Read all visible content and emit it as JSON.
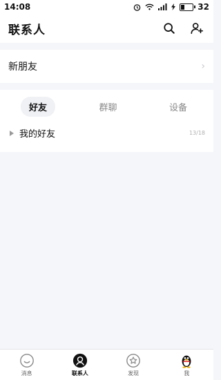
{
  "status_bar": {
    "time": "14:08",
    "battery": "32"
  },
  "header": {
    "title": "联系人"
  },
  "new_friends": {
    "label": "新朋友"
  },
  "tabs": [
    {
      "label": "好友",
      "active": true
    },
    {
      "label": "群聊",
      "active": false
    },
    {
      "label": "设备",
      "active": false
    }
  ],
  "groups": [
    {
      "label": "我的好友",
      "count": "13/18"
    }
  ],
  "bottom_nav": [
    {
      "label": "消息",
      "icon": "message-icon",
      "active": false
    },
    {
      "label": "联系人",
      "icon": "contacts-icon",
      "active": true
    },
    {
      "label": "发现",
      "icon": "discover-icon",
      "active": false
    },
    {
      "label": "我",
      "icon": "qq-penguin-icon",
      "active": false
    }
  ],
  "colors": {
    "accent": "#111111",
    "background": "#f5f6fa",
    "muted": "#888888"
  }
}
